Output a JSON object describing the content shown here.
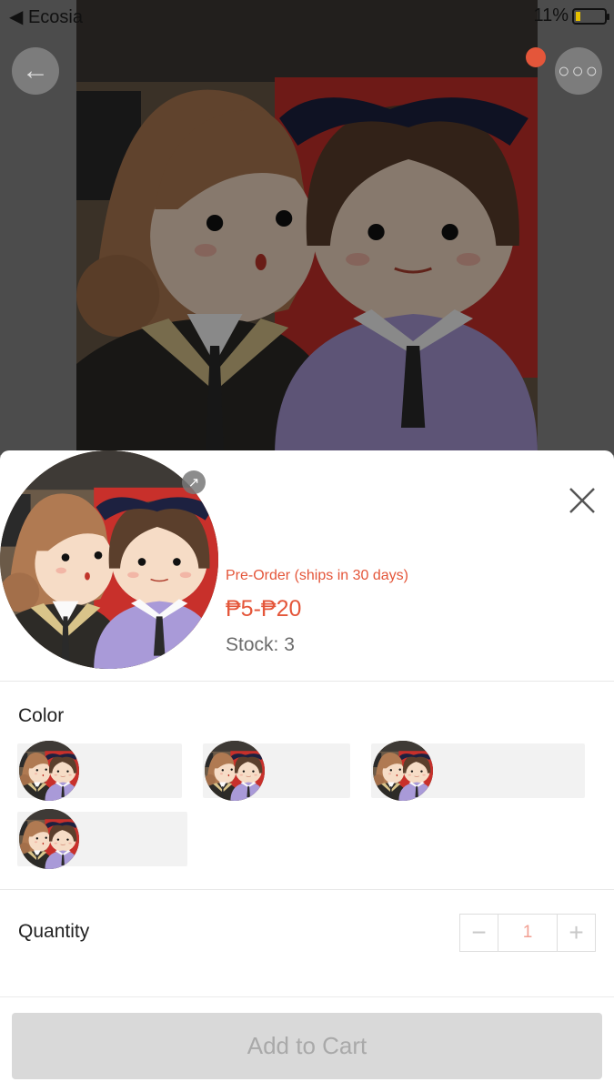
{
  "status_bar": {
    "carrier": "◀ Ecosia",
    "battery": "11%"
  },
  "background": {
    "back_icon": "arrow-left-icon",
    "more_icon": "more-dots-icon",
    "more_glyph": "○○○"
  },
  "product": {
    "preorder_text": "Pre-Order (ships in 30 days)",
    "price_range": "₱5-₱20",
    "stock": "Stock: 3"
  },
  "color_section": {
    "title": "Color",
    "options": [
      {
        "label": ""
      },
      {
        "label": ""
      },
      {
        "label": ""
      },
      {
        "label": ""
      }
    ]
  },
  "quantity_section": {
    "title": "Quantity",
    "minus": "−",
    "value": "1",
    "plus": "+"
  },
  "footer": {
    "add_to_cart": "Add to Cart"
  },
  "colors": {
    "accent": "#e4563a",
    "button_disabled": "#d9d9d9",
    "button_text_disabled": "#a9a9a9"
  }
}
